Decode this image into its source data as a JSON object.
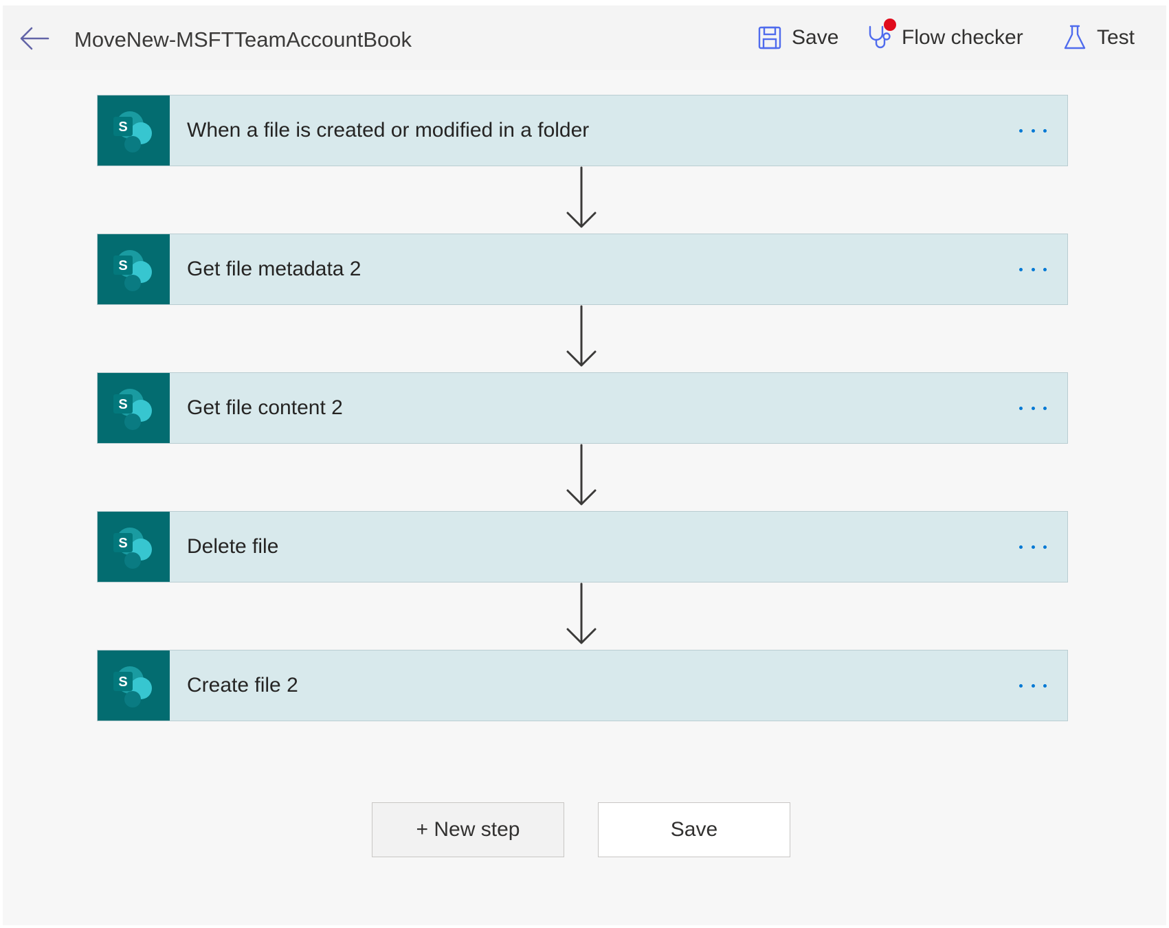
{
  "header": {
    "flow_name": "MoveNew-MSFTTeamAccountBook",
    "save_label": "Save",
    "flow_checker_label": "Flow checker",
    "test_label": "Test"
  },
  "steps": [
    {
      "title": "When a file is created or modified in a folder",
      "icon": "sharepoint-icon"
    },
    {
      "title": "Get file metadata 2",
      "icon": "sharepoint-icon"
    },
    {
      "title": "Get file content 2",
      "icon": "sharepoint-icon"
    },
    {
      "title": "Delete file",
      "icon": "sharepoint-icon"
    },
    {
      "title": "Create file 2",
      "icon": "sharepoint-icon"
    }
  ],
  "footer": {
    "new_step_label": "+ New step",
    "save_label": "Save"
  },
  "colors": {
    "sharepoint_teal": "#036c70",
    "step_background": "#d8e9ec",
    "accent_blue": "#0078d4",
    "alert_red": "#e00b1c"
  }
}
